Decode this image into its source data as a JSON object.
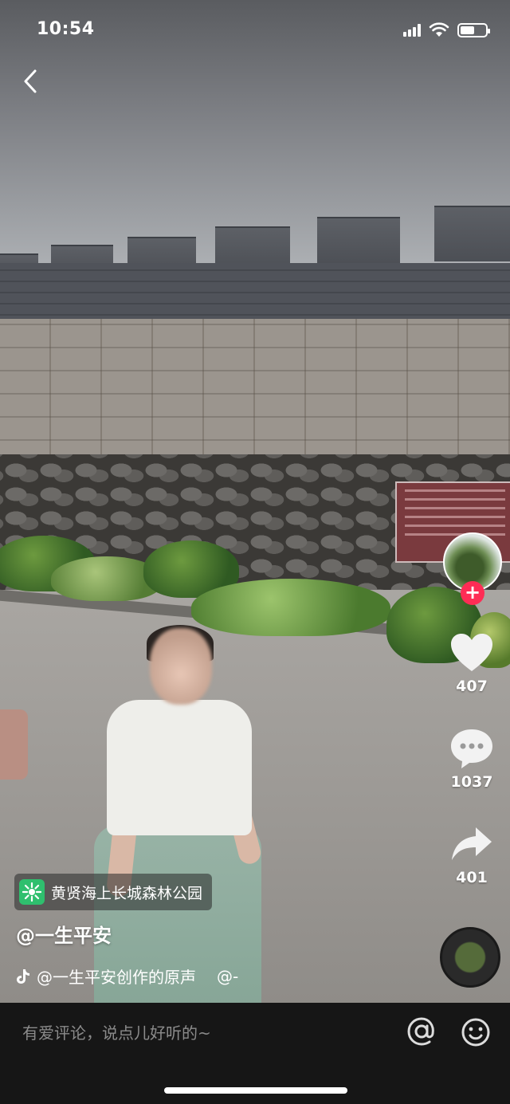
{
  "status_bar": {
    "time": "10:54",
    "battery_level": 0.55
  },
  "colors": {
    "accent": "#fe2c55",
    "location_badge": "#2fbf6e",
    "comment_bg": "#161616"
  },
  "icons": [
    "back-arrow-icon",
    "signal-icon",
    "wifi-icon",
    "battery-icon",
    "heart-icon",
    "comment-icon",
    "share-icon",
    "plus-icon",
    "location-icon",
    "tiktok-note-icon",
    "at-icon",
    "emoji-icon"
  ],
  "rail": {
    "likes": "407",
    "comments": "1037",
    "shares": "401",
    "follow_symbol": "+"
  },
  "video": {
    "location": "黄贤海上长城森林公园",
    "author": "@一生平安",
    "music": "@一生平安创作的原声",
    "music_tail": "@-"
  },
  "comment_bar": {
    "placeholder": "有爱评论，说点儿好听的~"
  }
}
